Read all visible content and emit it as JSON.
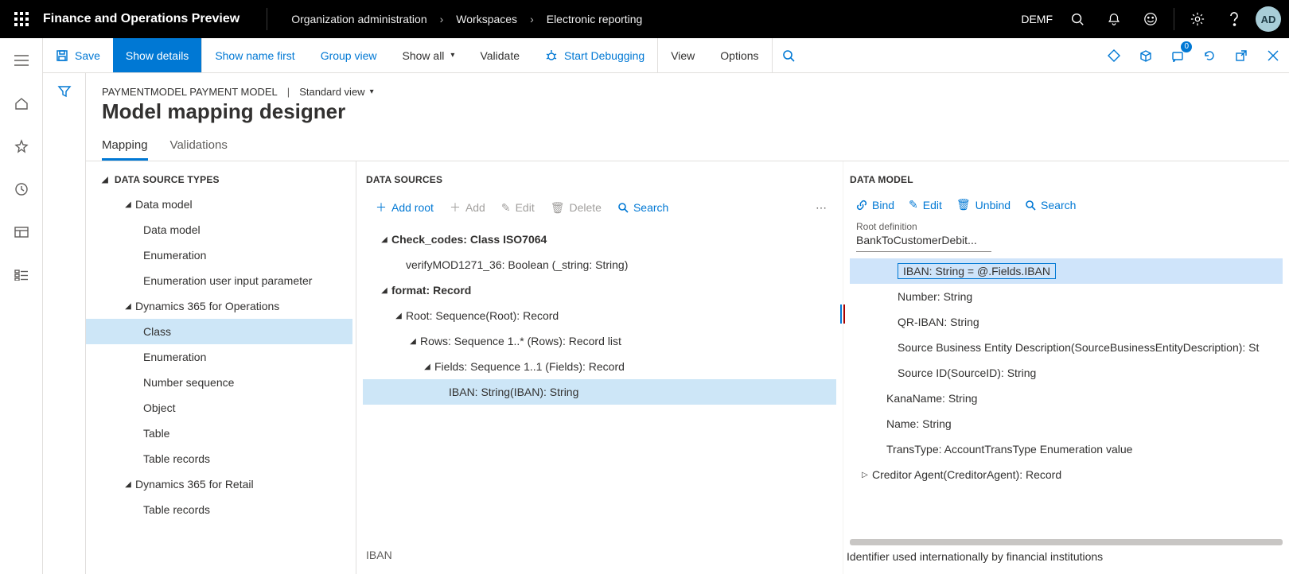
{
  "topbar": {
    "title": "Finance and Operations Preview",
    "breadcrumbs": [
      "Organization administration",
      "Workspaces",
      "Electronic reporting"
    ],
    "company": "DEMF",
    "avatar_initials": "AD"
  },
  "cmdrow": {
    "save": "Save",
    "show_details": "Show details",
    "show_name_first": "Show name first",
    "group_view": "Group view",
    "show_all": "Show all",
    "validate": "Validate",
    "start_debugging": "Start Debugging",
    "view": "View",
    "options": "Options",
    "msg_badge": "0"
  },
  "header": {
    "path_a": "PAYMENTMODEL PAYMENT MODEL",
    "path_sep": "|",
    "view_label": "Standard view",
    "title": "Model mapping designer"
  },
  "tabs": {
    "mapping": "Mapping",
    "validations": "Validations"
  },
  "left": {
    "heading": "DATA SOURCE TYPES",
    "items": {
      "data_model_group": "Data model",
      "data_model": "Data model",
      "enumeration1": "Enumeration",
      "enum_user_input": "Enumeration user input parameter",
      "d365fo_group": "Dynamics 365 for Operations",
      "class": "Class",
      "enumeration2": "Enumeration",
      "number_sequence": "Number sequence",
      "object": "Object",
      "table": "Table",
      "table_records1": "Table records",
      "d365retail_group": "Dynamics 365 for Retail",
      "table_records2": "Table records"
    }
  },
  "mid": {
    "heading": "DATA SOURCES",
    "toolbar": {
      "add_root": "Add root",
      "add": "Add",
      "edit": "Edit",
      "delete": "Delete",
      "search": "Search"
    },
    "rows": {
      "check_codes": "Check_codes: Class ISO7064",
      "verify": "verifyMOD1271_36: Boolean (_string: String)",
      "format": "format: Record",
      "root": "Root: Sequence(Root): Record",
      "rows_list": "Rows: Sequence 1..* (Rows): Record list",
      "fields": "Fields: Sequence 1..1 (Fields): Record",
      "iban": "IBAN: String(IBAN): String"
    },
    "footer": "IBAN"
  },
  "right": {
    "heading": "DATA MODEL",
    "toolbar": {
      "bind": "Bind",
      "edit": "Edit",
      "unbind": "Unbind",
      "search": "Search"
    },
    "root_definition_label": "Root definition",
    "root_definition_value": "BankToCustomerDebit...",
    "rows": {
      "iban": "IBAN: String = @.Fields.IBAN",
      "number": "Number: String",
      "qr_iban": "QR-IBAN: String",
      "source_bed": "Source Business Entity Description(SourceBusinessEntityDescription): St",
      "source_id": "Source ID(SourceID): String",
      "kana": "KanaName: String",
      "name": "Name: String",
      "trans": "TransType: AccountTransType Enumeration value",
      "creditor": "Creditor Agent(CreditorAgent): Record"
    },
    "footer": "Identifier used internationally by financial institutions"
  }
}
